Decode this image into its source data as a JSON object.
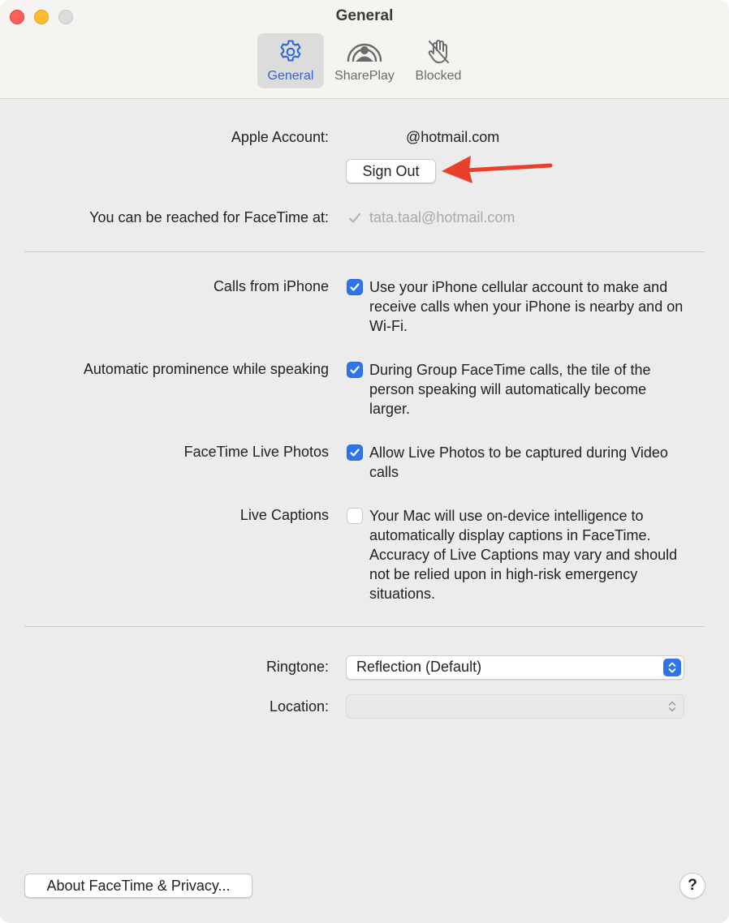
{
  "window": {
    "title": "General"
  },
  "tabs": [
    {
      "label": "General",
      "icon": "gear-icon",
      "active": true
    },
    {
      "label": "SharePlay",
      "icon": "shareplay-icon",
      "active": false
    },
    {
      "label": "Blocked",
      "icon": "hand-raised-slash-icon",
      "active": false
    }
  ],
  "account": {
    "label": "Apple Account:",
    "value": "@hotmail.com",
    "sign_out_label": "Sign Out"
  },
  "reach": {
    "label": "You can be reached for FaceTime at:",
    "address": "tata.taal@hotmail.com",
    "checked": true
  },
  "options": [
    {
      "label": "Calls from iPhone",
      "checked": true,
      "desc": "Use your iPhone cellular account to make and receive calls when your iPhone is nearby and on Wi-Fi."
    },
    {
      "label": "Automatic prominence while speaking",
      "checked": true,
      "desc": "During Group FaceTime calls, the tile of the person speaking will automatically become larger."
    },
    {
      "label": "FaceTime Live Photos",
      "checked": true,
      "desc": "Allow Live Photos to be captured during Video calls"
    },
    {
      "label": "Live Captions",
      "checked": false,
      "desc": "Your Mac will use on-device intelligence to automatically display captions in FaceTime. Accuracy of Live Captions may vary and should not be relied upon in high-risk emergency situations."
    }
  ],
  "ringtone": {
    "label": "Ringtone:",
    "value": "Reflection (Default)"
  },
  "location": {
    "label": "Location:",
    "value": ""
  },
  "footer": {
    "about_label": "About FaceTime & Privacy...",
    "help_label": "?"
  },
  "colors": {
    "accent": "#2f74e8",
    "annotation_arrow": "#e8402a"
  }
}
